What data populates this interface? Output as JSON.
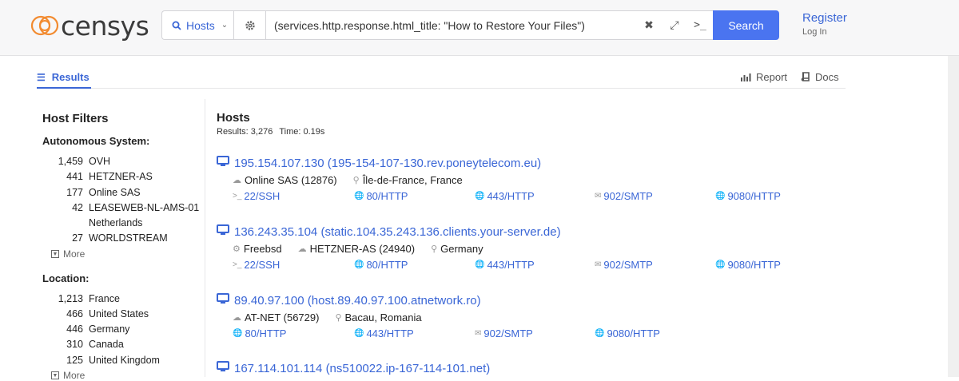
{
  "header": {
    "logo_text": "censys",
    "type_select": "Hosts",
    "query": "(services.http.response.html_title: \"How to Restore Your Files\")",
    "search_label": "Search",
    "register_label": "Register",
    "login_label": "Log In"
  },
  "tabs": {
    "results": "Results",
    "report": "Report",
    "docs": "Docs"
  },
  "sidebar": {
    "title": "Host Filters",
    "sections": [
      {
        "label": "Autonomous System:",
        "items": [
          {
            "count": "1,459",
            "label": "OVH"
          },
          {
            "count": "441",
            "label": "HETZNER-AS"
          },
          {
            "count": "177",
            "label": "Online SAS"
          },
          {
            "count": "42",
            "label": "LEASEWEB-NL-AMS-01",
            "label2": "Netherlands"
          },
          {
            "count": "27",
            "label": "WORLDSTREAM"
          }
        ],
        "more": "More"
      },
      {
        "label": "Location:",
        "items": [
          {
            "count": "1,213",
            "label": "France"
          },
          {
            "count": "466",
            "label": "United States"
          },
          {
            "count": "446",
            "label": "Germany"
          },
          {
            "count": "310",
            "label": "Canada"
          },
          {
            "count": "125",
            "label": "United Kingdom"
          }
        ],
        "more": "More"
      }
    ]
  },
  "main": {
    "title": "Hosts",
    "results_text": "Results: 3,276",
    "time_text": "Time: 0.19s",
    "hosts": [
      {
        "ip": "195.154.107.130",
        "hostname": "(195-154-107-130.rev.poneytelecom.eu)",
        "info": [
          {
            "icon": "cloud-icon",
            "text": "Online SAS (12876)"
          },
          {
            "icon": "location-pin-icon",
            "text": "Île-de-France, France"
          }
        ],
        "services": [
          {
            "icon": "terminal-icon",
            "text": "22/SSH"
          },
          {
            "icon": "globe-icon",
            "text": "80/HTTP"
          },
          {
            "icon": "globe-icon",
            "text": "443/HTTP"
          },
          {
            "icon": "envelope-icon",
            "text": "902/SMTP"
          },
          {
            "icon": "globe-icon",
            "text": "9080/HTTP"
          }
        ]
      },
      {
        "ip": "136.243.35.104",
        "hostname": "(static.104.35.243.136.clients.your-server.de)",
        "info": [
          {
            "icon": "gear-icon",
            "text": "Freebsd"
          },
          {
            "icon": "cloud-icon",
            "text": "HETZNER-AS (24940)"
          },
          {
            "icon": "location-pin-icon",
            "text": "Germany"
          }
        ],
        "services": [
          {
            "icon": "terminal-icon",
            "text": "22/SSH"
          },
          {
            "icon": "globe-icon",
            "text": "80/HTTP"
          },
          {
            "icon": "globe-icon",
            "text": "443/HTTP"
          },
          {
            "icon": "envelope-icon",
            "text": "902/SMTP"
          },
          {
            "icon": "globe-icon",
            "text": "9080/HTTP"
          }
        ]
      },
      {
        "ip": "89.40.97.100",
        "hostname": "(host.89.40.97.100.atnetwork.ro)",
        "info": [
          {
            "icon": "cloud-icon",
            "text": "AT-NET (56729)"
          },
          {
            "icon": "location-pin-icon",
            "text": "Bacau, Romania"
          }
        ],
        "services": [
          {
            "icon": "globe-icon",
            "text": "80/HTTP"
          },
          {
            "icon": "globe-icon",
            "text": "443/HTTP"
          },
          {
            "icon": "envelope-icon",
            "text": "902/SMTP"
          },
          {
            "icon": "globe-icon",
            "text": "9080/HTTP"
          }
        ]
      },
      {
        "ip": "167.114.101.114",
        "hostname": "(ns510022.ip-167-114-101.net)",
        "info": [],
        "services": []
      }
    ]
  },
  "colors": {
    "accent": "#3a66d6",
    "search_button": "#4a74f0",
    "logo_orange": "#f28b30"
  }
}
